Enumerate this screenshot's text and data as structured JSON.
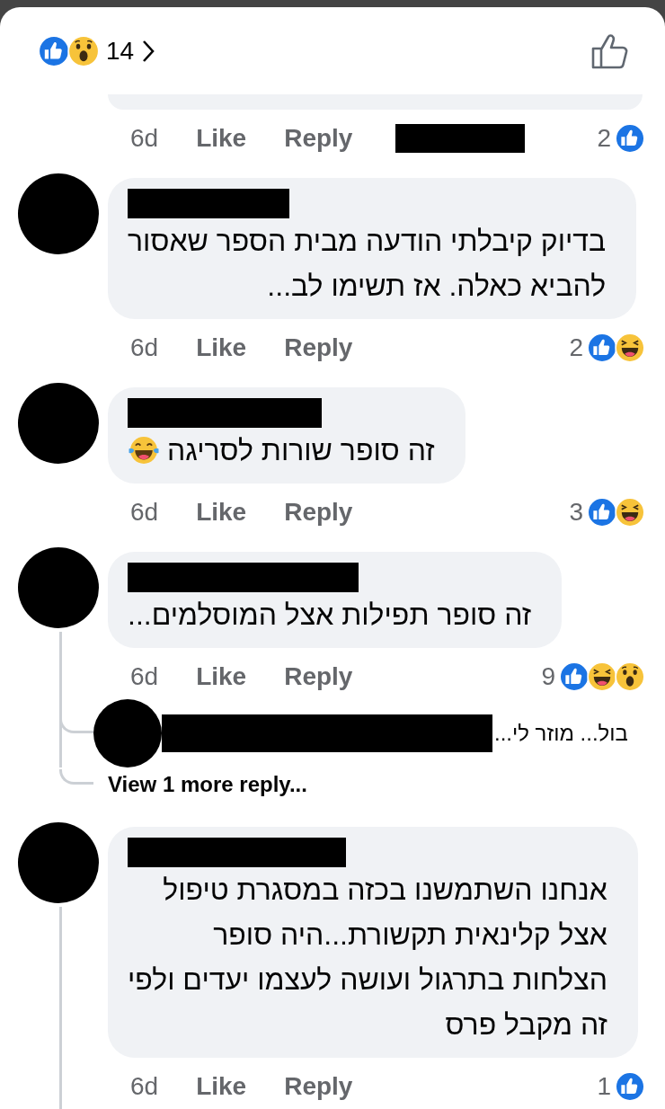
{
  "header": {
    "reactions": [
      {
        "kind": "like"
      },
      {
        "kind": "wow"
      }
    ],
    "count": "14"
  },
  "comments": [
    {
      "kind": "partial",
      "time": "6d",
      "like": "Like",
      "reply": "Reply",
      "reaction_count": "2",
      "reactions": [
        {
          "kind": "like"
        }
      ],
      "thread_line": false
    },
    {
      "kind": "full",
      "lines": [
        "בדיוק קיבלתי הודעה מבית הספר שאסור",
        "להביא כאלה. אז תשימו לב..."
      ],
      "time": "6d",
      "like": "Like",
      "reply": "Reply",
      "reaction_count": "2",
      "reactions": [
        {
          "kind": "like"
        },
        {
          "kind": "haha"
        }
      ],
      "thread_line": false
    },
    {
      "kind": "full",
      "lines": [
        "זה סופר שורות לסריגה"
      ],
      "emoji": {
        "kind": "tears"
      },
      "time": "6d",
      "like": "Like",
      "reply": "Reply",
      "reaction_count": "3",
      "reactions": [
        {
          "kind": "like"
        },
        {
          "kind": "haha"
        }
      ],
      "thread_line": false
    },
    {
      "kind": "full",
      "lines": [
        "זה סופר תפילות אצל המוסלמים..."
      ],
      "time": "6d",
      "like": "Like",
      "reply": "Reply",
      "reaction_count": "9",
      "reactions": [
        {
          "kind": "like"
        },
        {
          "kind": "haha"
        },
        {
          "kind": "wow"
        }
      ],
      "thread_line": true,
      "replies": [
        {
          "text": "בול... מוזר לי..."
        }
      ],
      "more_replies": "View 1 more reply..."
    },
    {
      "kind": "full",
      "lines": [
        "אנחנו השתמשנו בכזה במסגרת טיפול",
        "אצל קלינאית תקשורת...היה סופר",
        "הצלחות בתרגול ועושה לעצמו יעדים ולפי",
        "זה מקבל פרס"
      ],
      "time": "6d",
      "like": "Like",
      "reply": "Reply",
      "reaction_count": "1",
      "reactions": [
        {
          "kind": "like"
        }
      ],
      "thread_line": true
    }
  ]
}
